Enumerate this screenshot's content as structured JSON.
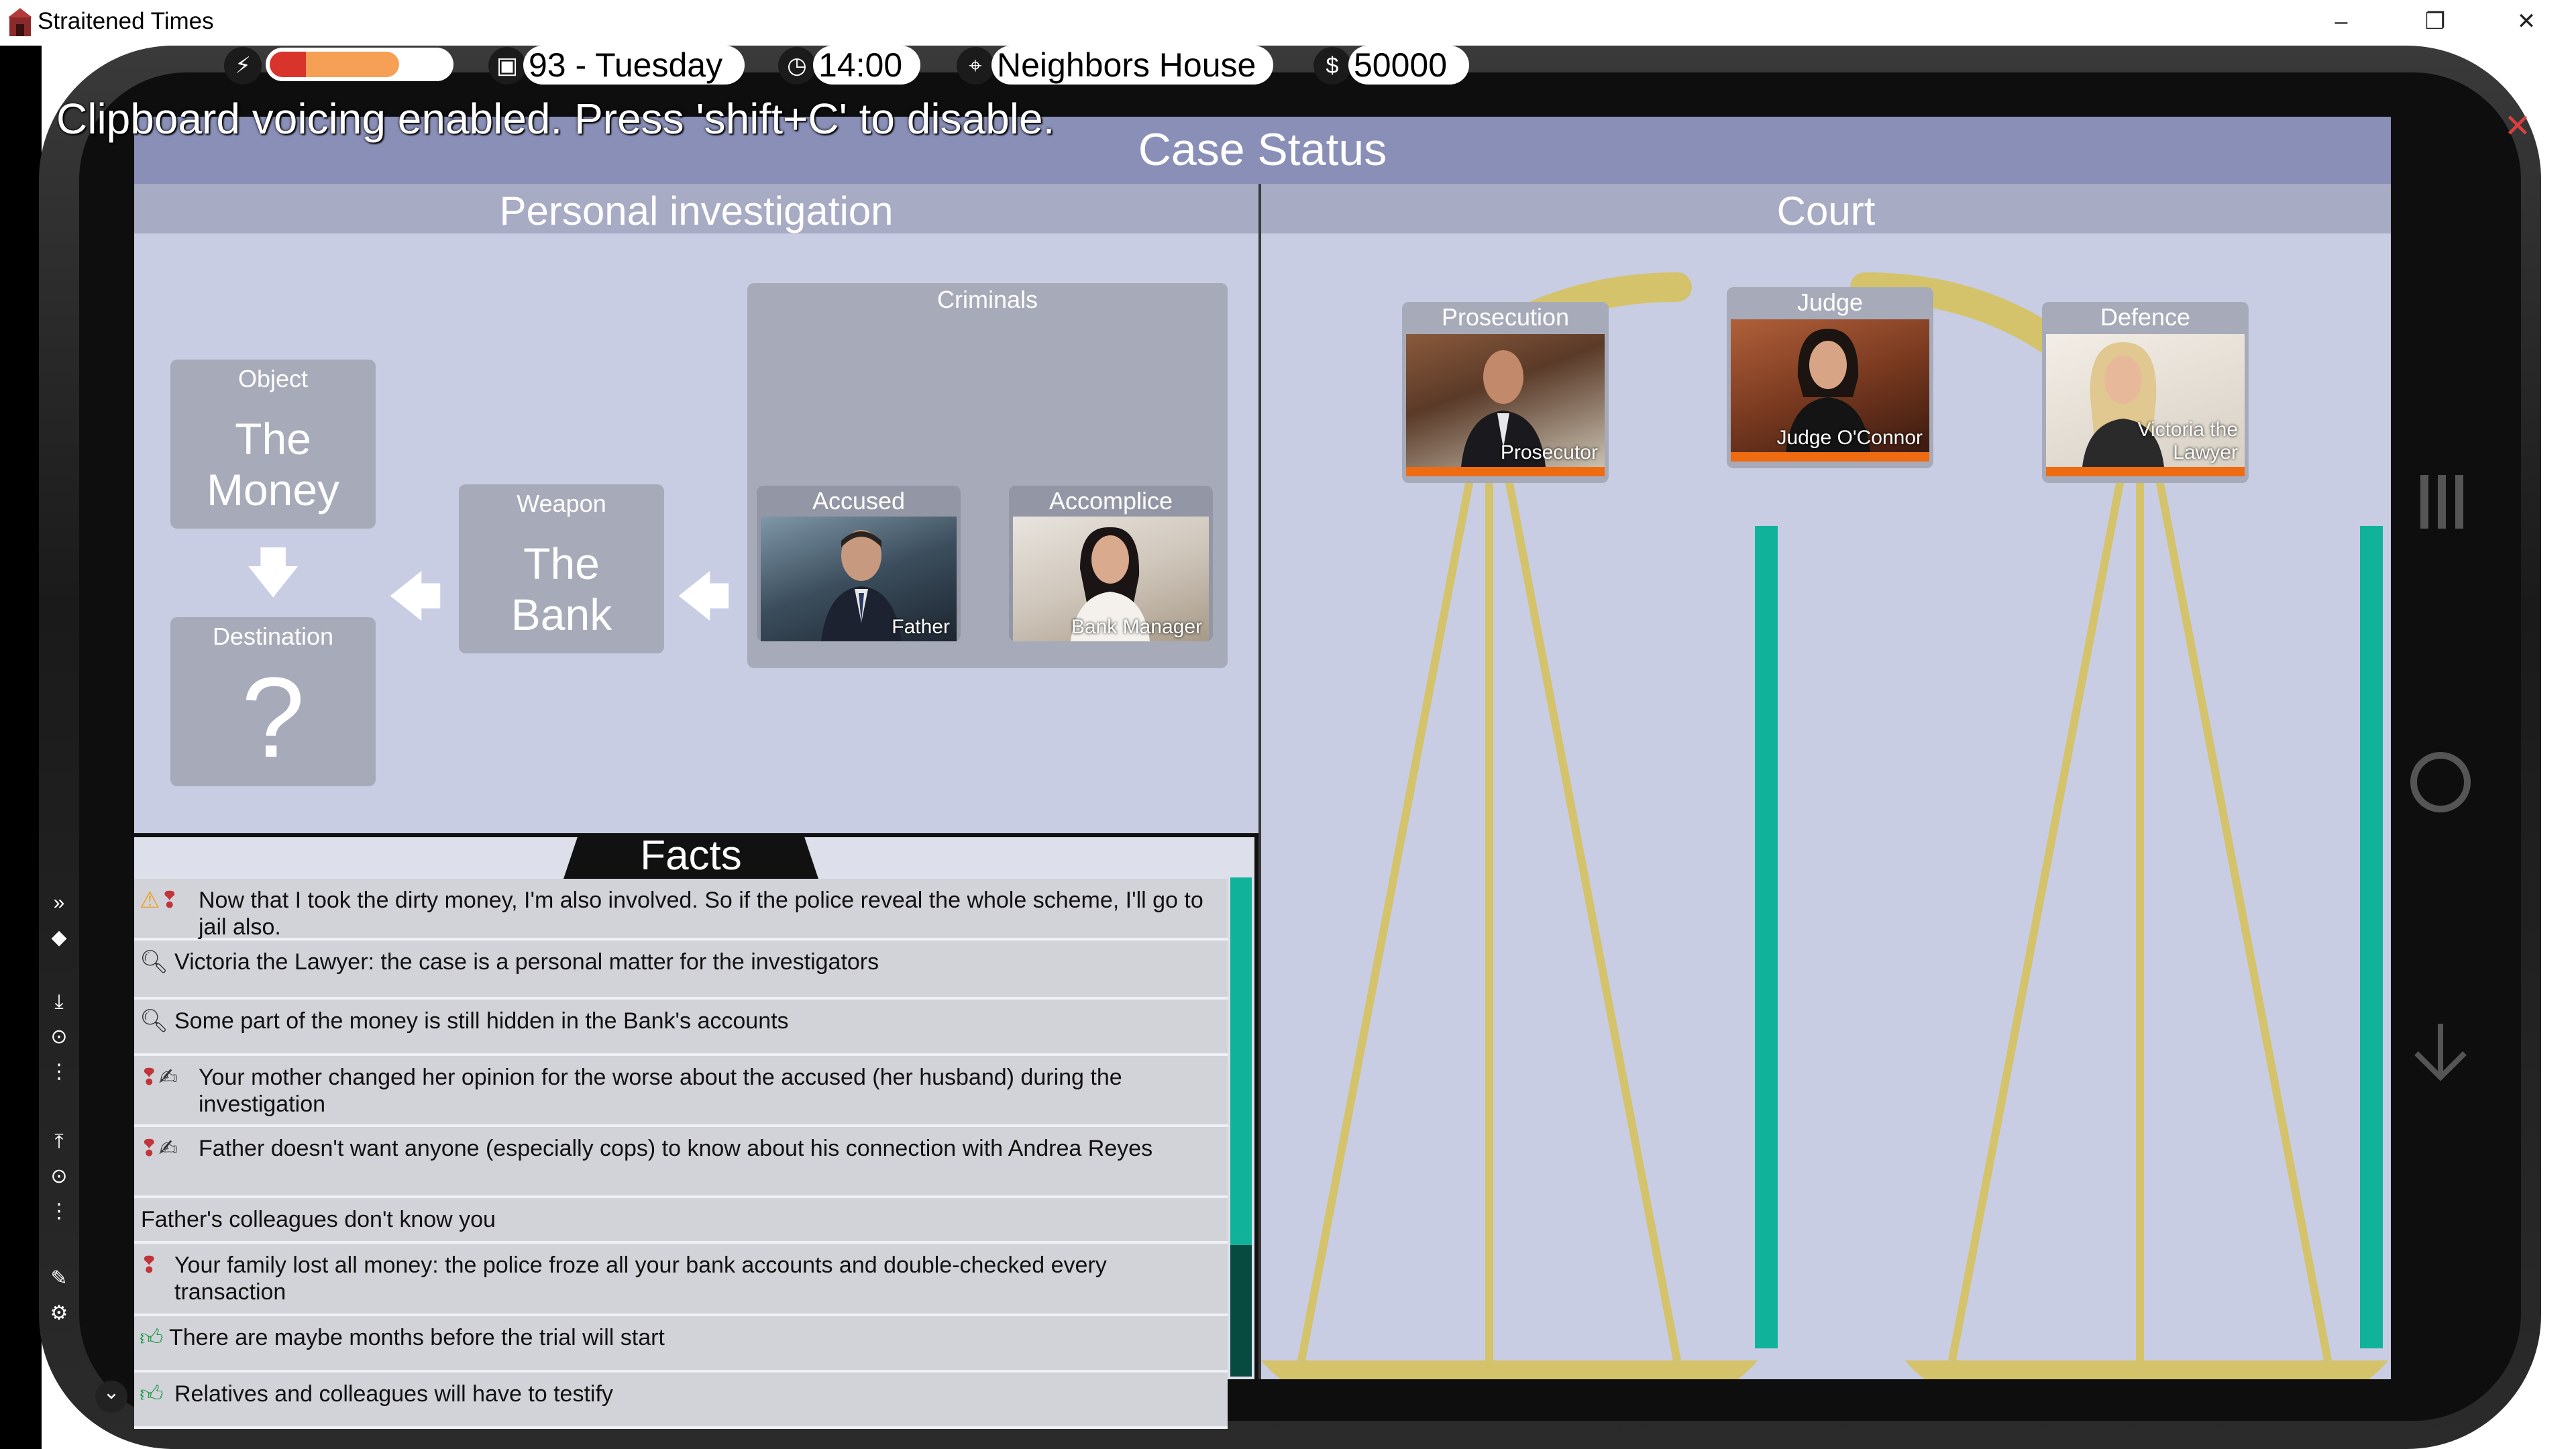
{
  "window": {
    "title": "Straitened Times",
    "minimize": "–",
    "restore": "❐",
    "close": "✕"
  },
  "status": {
    "energy_level": 0.72,
    "day": "93 - Tuesday",
    "time": "14:00",
    "location": "Neighbors House",
    "money": "50000"
  },
  "notice": "Clipboard voicing enabled. Press 'shift+C' to disable.",
  "panel": {
    "title": "Case Status",
    "investigation": {
      "title": "Personal investigation",
      "object": {
        "label": "Object",
        "value_line1": "The",
        "value_line2": "Money"
      },
      "destination": {
        "label": "Destination",
        "value": "?"
      },
      "weapon": {
        "label": "Weapon",
        "value_line1": "The",
        "value_line2": "Bank"
      },
      "criminals": {
        "label": "Criminals",
        "accused": {
          "label": "Accused",
          "name": "Father"
        },
        "accomplice": {
          "label": "Accomplice",
          "name": "Bank Manager"
        }
      }
    },
    "facts": {
      "title": "Facts",
      "items": [
        {
          "text": "Now that I took the dirty money, I'm also involved. So if the police reveal the whole scheme, I'll go to jail also."
        },
        {
          "text": "Victoria the Lawyer: the case is a personal matter for the investigators"
        },
        {
          "text": "Some part of the money is still hidden in the Bank's accounts"
        },
        {
          "text": "Your mother changed her opinion for the worse about the accused (her husband) during the investigation"
        },
        {
          "text": "Father doesn't want anyone (especially cops) to know about his connection with Andrea Reyes"
        },
        {
          "text": "Father's colleagues don't know you"
        },
        {
          "text": "Your family lost all money: the police froze all your bank accounts and double-checked every transaction"
        },
        {
          "text": "There are maybe months before the trial will start"
        },
        {
          "text": "Relatives and colleagues will have to testify"
        }
      ]
    },
    "court": {
      "title": "Court",
      "prosecution": {
        "label": "Prosecution",
        "name": "Prosecutor"
      },
      "judge": {
        "label": "Judge",
        "name": "Judge O'Connor"
      },
      "defence": {
        "label": "Defence",
        "name_line1": "Victoria the",
        "name_line2": "Lawyer"
      }
    }
  },
  "colors": {
    "panel_bg": "#c8cde3",
    "header_bg": "#8a8fb7",
    "card_bg": "#a7abb9",
    "scale_gold": "#d4c36a",
    "teal": "#10b39a",
    "orange": "#ef6b12"
  }
}
